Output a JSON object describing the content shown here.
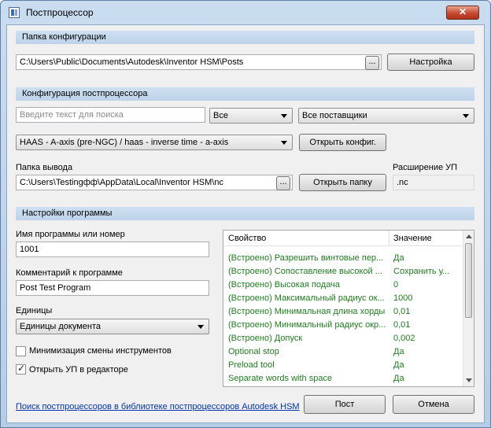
{
  "window": {
    "title": "Постпроцессор",
    "close_glyph": "✕"
  },
  "config_section": {
    "header": "Папка конфигурации",
    "path": "C:\\Users\\Public\\Documents\\Autodesk\\Inventor HSM\\Posts",
    "browse": "...",
    "settings_button": "Настройка"
  },
  "post_section": {
    "header": "Конфигурация постпроцессора",
    "search_placeholder": "Введите текст для поиска",
    "filter_all": "Все",
    "vendors": "Все поставщики",
    "post_selected": "HAAS - A-axis (pre-NGC) / haas - inverse time - a-axis",
    "open_config_button": "Открыть конфиг."
  },
  "output": {
    "label": "Папка вывода",
    "path": "C:\\Users\\Testingфф\\AppData\\Local\\Inventor HSM\\nc",
    "browse": "...",
    "open_folder_button": "Открыть папку",
    "ext_label": "Расширение УП",
    "ext_value": ".nc"
  },
  "program_section": {
    "header": "Настройки программы",
    "name_label": "Имя программы или номер",
    "name_value": "1001",
    "comment_label": "Комментарий к программе",
    "comment_value": "Post Test Program",
    "units_label": "Единицы",
    "units_value": "Единицы документа",
    "minimize_tool_changes": {
      "label": "Минимизация смены инструментов",
      "checked": false
    },
    "open_in_editor": {
      "label": "Открыть УП в редакторе",
      "checked": true,
      "mark": "✓"
    }
  },
  "properties": {
    "col_property": "Свойство",
    "col_value": "Значение",
    "rows": [
      {
        "name": "(Встроено) Разрешить винтовые пер...",
        "value": "Да"
      },
      {
        "name": "(Встроено) Сопоставление высокой ...",
        "value": "Сохранить у..."
      },
      {
        "name": "(Встроено) Высокая подача",
        "value": "0"
      },
      {
        "name": "(Встроено) Максимальный радиус ок...",
        "value": "1000"
      },
      {
        "name": "(Встроено) Минимальная длина хорды",
        "value": "0,01"
      },
      {
        "name": "(Встроено) Минимальный радиус окр...",
        "value": "0,01"
      },
      {
        "name": "(Встроено) Допуск",
        "value": "0,002"
      },
      {
        "name": "Optional stop",
        "value": "Да"
      },
      {
        "name": "Preload tool",
        "value": "Да"
      },
      {
        "name": "Separate words with space",
        "value": "Да"
      }
    ]
  },
  "footer": {
    "link": "Поиск постпроцессоров в библиотеке постпроцессоров Autodesk HSM",
    "post_button": "Пост",
    "cancel_button": "Отмена"
  }
}
